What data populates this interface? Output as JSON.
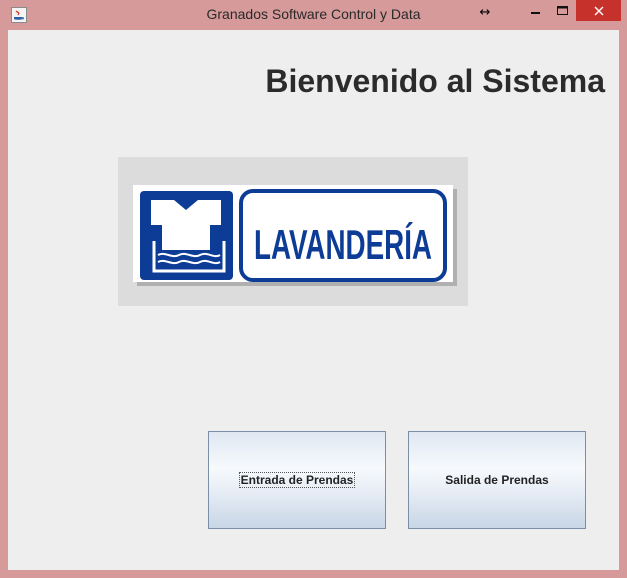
{
  "window": {
    "title": "Granados Software Control y Data",
    "controls": {
      "resize_glyph": "↔",
      "minimize_glyph": "–",
      "maximize_glyph": "☐",
      "close_glyph": "✕"
    }
  },
  "main": {
    "heading": "Bienvenido al Sistema",
    "logo_text": "LAVANDERÍA",
    "buttons": {
      "entrada_label": "Entrada de Prendas",
      "salida_label": "Salida de Prendas"
    }
  },
  "colors": {
    "title_bar": "#d69a9a",
    "client_bg": "#eeeeee",
    "close_button": "#c7312b",
    "logo_blue": "#0d3c97"
  },
  "icons": {
    "app": "java-app-icon",
    "logo_symbol": "laundry-shirt-water-icon"
  }
}
